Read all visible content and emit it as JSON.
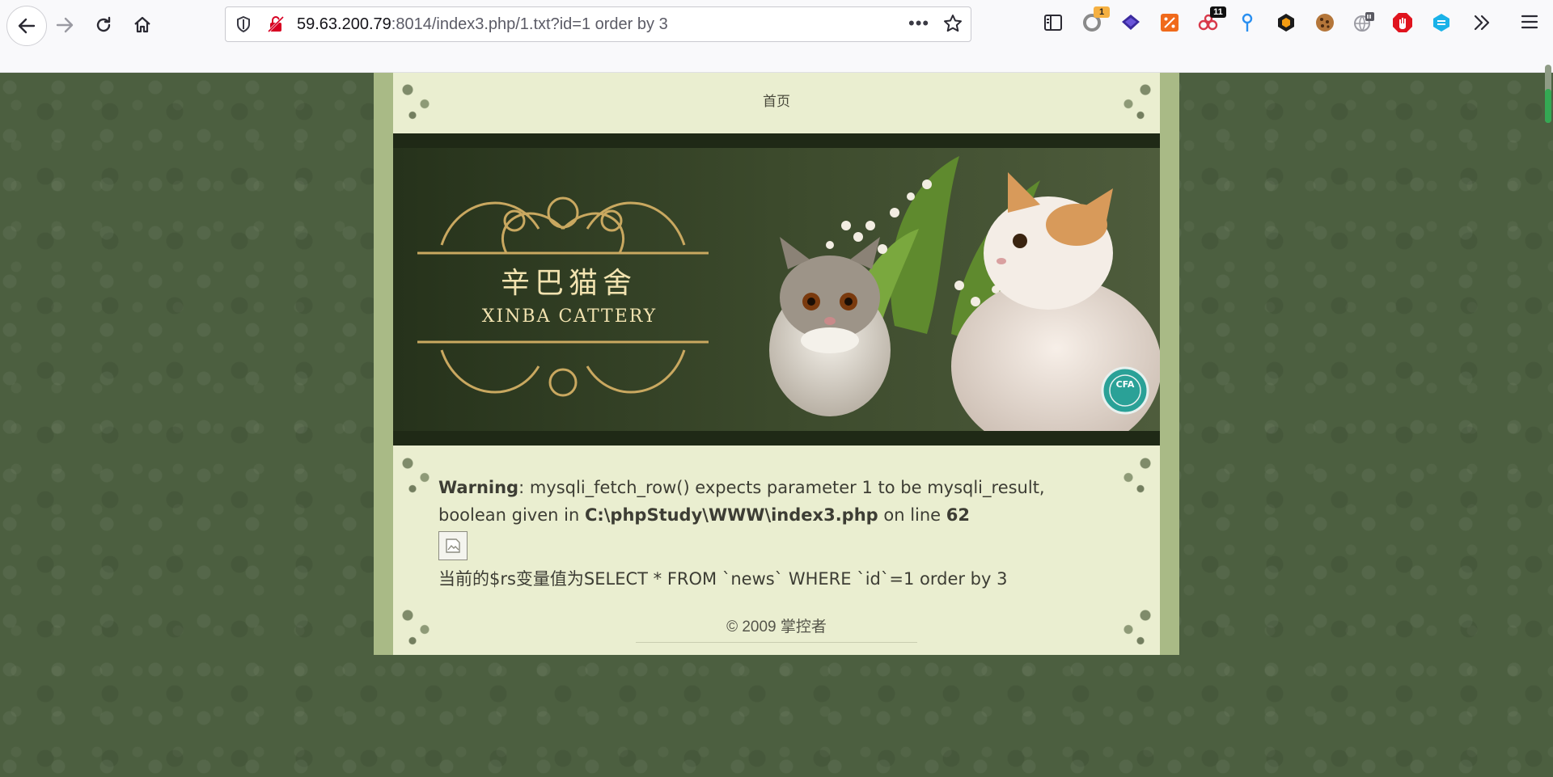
{
  "browser": {
    "url_host": "59.63.200.79",
    "url_rest": ":8014/index3.php/1.txt?id=1 order by 3",
    "page_actions": "•••",
    "extensions": [
      {
        "name": "reader-view-icon",
        "badge": ""
      },
      {
        "name": "extension-circle-icon",
        "badge": "1",
        "badge_color": "#f5b041"
      },
      {
        "name": "extension-layers-icon",
        "badge": ""
      },
      {
        "name": "extension-percent-icon",
        "badge": ""
      },
      {
        "name": "extension-nodes-icon",
        "badge": "11",
        "badge_color": "#111111"
      },
      {
        "name": "extension-pin-icon",
        "badge": ""
      },
      {
        "name": "extension-hex-icon",
        "badge": ""
      },
      {
        "name": "extension-cookie-icon",
        "badge": ""
      },
      {
        "name": "extension-globe-icon",
        "badge": ""
      },
      {
        "name": "extension-stop-icon",
        "badge": ""
      },
      {
        "name": "extension-cube-icon",
        "badge": ""
      }
    ],
    "colors": {
      "accent_red": "#d70022",
      "toolbar_bg": "#f9f9fb"
    }
  },
  "site": {
    "nav_home": "首页",
    "banner": {
      "title_cn": "辛巴猫舍",
      "title_en": "XINBA CATTERY",
      "badge_text": "CFA"
    },
    "warning": {
      "label": "Warning",
      "text_1": ": mysqli_fetch_row() expects parameter 1 to be mysqli_result, boolean given in ",
      "path": "C:\\phpStudy\\WWW\\index3.php",
      "text_2": " on line ",
      "line": "62"
    },
    "query_text": "当前的$rs变量值为SELECT * FROM `news` WHERE `id`=1 order by 3",
    "footer": "© 2009 掌控者"
  }
}
